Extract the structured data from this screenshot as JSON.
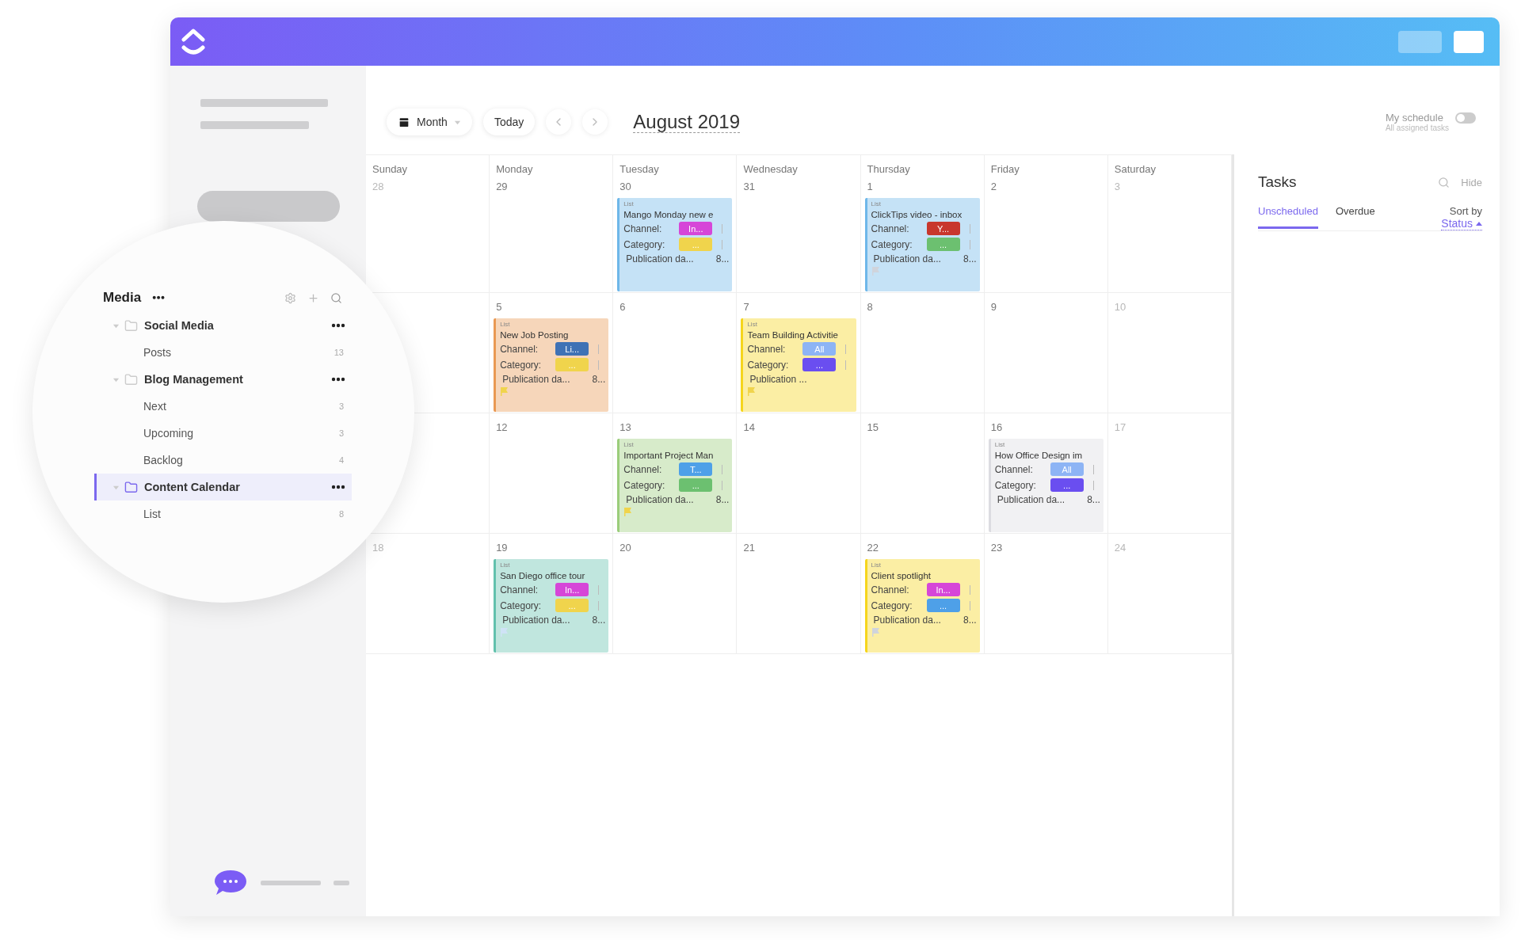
{
  "sidebar": {
    "tree": {
      "title": "Media",
      "folders": [
        {
          "name": "Social Media",
          "expanded": true,
          "selected": false,
          "children": [
            {
              "name": "Posts",
              "count": "13"
            }
          ]
        },
        {
          "name": "Blog Management",
          "expanded": true,
          "selected": false,
          "children": [
            {
              "name": "Next",
              "count": "3"
            },
            {
              "name": "Upcoming",
              "count": "3"
            },
            {
              "name": "Backlog",
              "count": "4"
            }
          ]
        },
        {
          "name": "Content Calendar",
          "expanded": true,
          "selected": true,
          "children": [
            {
              "name": "List",
              "count": "8"
            }
          ]
        }
      ]
    }
  },
  "toolbar": {
    "view": "Month",
    "today": "Today",
    "title": "August 2019",
    "my_schedule": {
      "label": "My schedule",
      "sublabel": "All assigned tasks",
      "on": false
    }
  },
  "calendar": {
    "weekdays": [
      "Sunday",
      "Monday",
      "Tuesday",
      "Wednesday",
      "Thursday",
      "Friday",
      "Saturday"
    ],
    "weeks": [
      [
        {
          "date": "28",
          "muted": true
        },
        {
          "date": "29",
          "muted": false
        },
        {
          "date": "30",
          "muted": false,
          "event": {
            "list": "List",
            "title": "Mango Monday new e",
            "color": "#c5e2f6",
            "fields": [
              {
                "label": "Channel:",
                "tag": "In...",
                "color": "#d646d8"
              },
              {
                "label": "Category:",
                "tag": "...",
                "color": "#f0d44c"
              }
            ],
            "publication": "Publication da...",
            "publication_value": "8..."
          }
        },
        {
          "date": "31",
          "muted": false
        },
        {
          "date": "1",
          "muted": false,
          "event": {
            "list": "List",
            "title": "ClickTips video - inbox",
            "color": "#c5e2f6",
            "fields": [
              {
                "label": "Channel:",
                "tag": "Y...",
                "color": "#c8372d"
              },
              {
                "label": "Category:",
                "tag": "...",
                "color": "#6cc070"
              }
            ],
            "publication": "Publication da...",
            "publication_value": "8...",
            "flag": {
              "color": "#d0d4dc"
            }
          }
        },
        {
          "date": "2",
          "muted": false
        },
        {
          "date": "3",
          "muted": true
        }
      ],
      [
        {
          "date": "5",
          "muted": false,
          "event": {
            "list": "List",
            "title": "New Job Posting",
            "color": "#f6d6ba",
            "fields": [
              {
                "label": "Channel:",
                "tag": "Li...",
                "color": "#3f72b5"
              },
              {
                "label": "Category:",
                "tag": "...",
                "color": "#f0d44c"
              }
            ],
            "publication": "Publication da...",
            "publication_value": "8...",
            "flag": {
              "color": "#f0d44c"
            }
          }
        },
        {
          "date": "6",
          "muted": false
        },
        {
          "date": "7",
          "muted": false,
          "event": {
            "list": "List",
            "title": "Team Building Activitie",
            "color": "#fbeea4",
            "fields": [
              {
                "label": "Channel:",
                "tag": "All",
                "color": "#8db4f5"
              },
              {
                "label": "Category:",
                "tag": "...",
                "color": "#6a4ef0"
              }
            ],
            "publication": "Publication ...",
            "flag": {
              "color": "#f0d44c"
            }
          }
        },
        {
          "date": "8",
          "muted": false
        },
        {
          "date": "9",
          "muted": false
        },
        {
          "date": "10",
          "muted": true
        }
      ],
      [
        {
          "date": "12",
          "muted": false
        },
        {
          "date": "13",
          "muted": false,
          "event": {
            "list": "List",
            "title": "Important Project Man",
            "color": "#d7ebca",
            "fields": [
              {
                "label": "Channel:",
                "tag": "T...",
                "color": "#4ea0e8"
              },
              {
                "label": "Category:",
                "tag": "...",
                "color": "#6cc070"
              }
            ],
            "publication": "Publication da...",
            "publication_value": "8...",
            "flag": {
              "color": "#f0d44c"
            }
          }
        },
        {
          "date": "14",
          "muted": false
        },
        {
          "date": "15",
          "muted": false
        },
        {
          "date": "16",
          "muted": false,
          "event": {
            "list": "List",
            "title": "How Office Design im",
            "color": "#f1f1f3",
            "fields": [
              {
                "label": "Channel:",
                "tag": "All",
                "color": "#8db4f5"
              },
              {
                "label": "Category:",
                "tag": "...",
                "color": "#6a4ef0"
              }
            ],
            "publication": "Publication da...",
            "publication_value": "8..."
          }
        },
        {
          "date": "17",
          "muted": true
        }
      ],
      [
        {
          "date": "18",
          "muted": true
        },
        {
          "date": "19",
          "muted": false,
          "event": {
            "list": "List",
            "title": "San Diego office tour",
            "color": "#c0e6de",
            "fields": [
              {
                "label": "Channel:",
                "tag": "In...",
                "color": "#d646d8"
              },
              {
                "label": "Category:",
                "tag": "...",
                "color": "#f0d44c"
              }
            ],
            "publication": "Publication da...",
            "publication_value": "8...",
            "flag": {
              "color": "#cfe3f6"
            }
          }
        },
        {
          "date": "20",
          "muted": false
        },
        {
          "date": "21",
          "muted": false
        },
        {
          "date": "22",
          "muted": false,
          "event": {
            "list": "List",
            "title": "Client spotlight",
            "color": "#fbeea4",
            "fields": [
              {
                "label": "Channel:",
                "tag": "In...",
                "color": "#d646d8"
              },
              {
                "label": "Category:",
                "tag": "...",
                "color": "#4ea0e8"
              }
            ],
            "publication": "Publication da...",
            "publication_value": "8...",
            "flag": {
              "color": "#d0d4dc"
            }
          }
        },
        {
          "date": "23",
          "muted": false
        },
        {
          "date": "24",
          "muted": true
        }
      ]
    ]
  },
  "tasks_panel": {
    "title": "Tasks",
    "hide": "Hide",
    "tabs": [
      {
        "label": "Unscheduled",
        "selected": true
      },
      {
        "label": "Overdue",
        "selected": false
      }
    ],
    "sort_label": "Sort by",
    "sort_value": "Status"
  }
}
